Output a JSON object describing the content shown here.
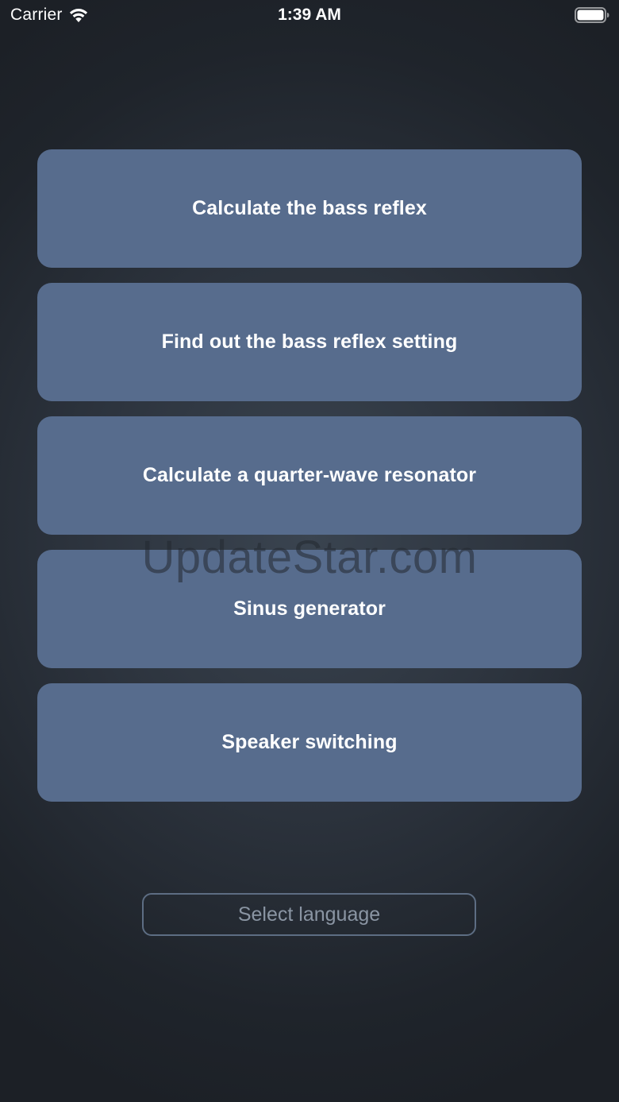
{
  "status_bar": {
    "carrier": "Carrier",
    "time": "1:39 AM",
    "wifi_icon": "wifi-icon",
    "battery_icon": "battery-full-icon"
  },
  "menu": {
    "items": [
      {
        "label": "Calculate the bass reflex"
      },
      {
        "label": "Find out the bass reflex setting"
      },
      {
        "label": "Calculate a quarter-wave resonator"
      },
      {
        "label": "Sinus generator"
      },
      {
        "label": "Speaker switching"
      }
    ]
  },
  "watermark": "UpdateStar.com",
  "language_button": {
    "label": "Select language"
  },
  "colors": {
    "button_fill": "#576c8d",
    "background": "#2c333d",
    "outline": "#5d6d83"
  }
}
